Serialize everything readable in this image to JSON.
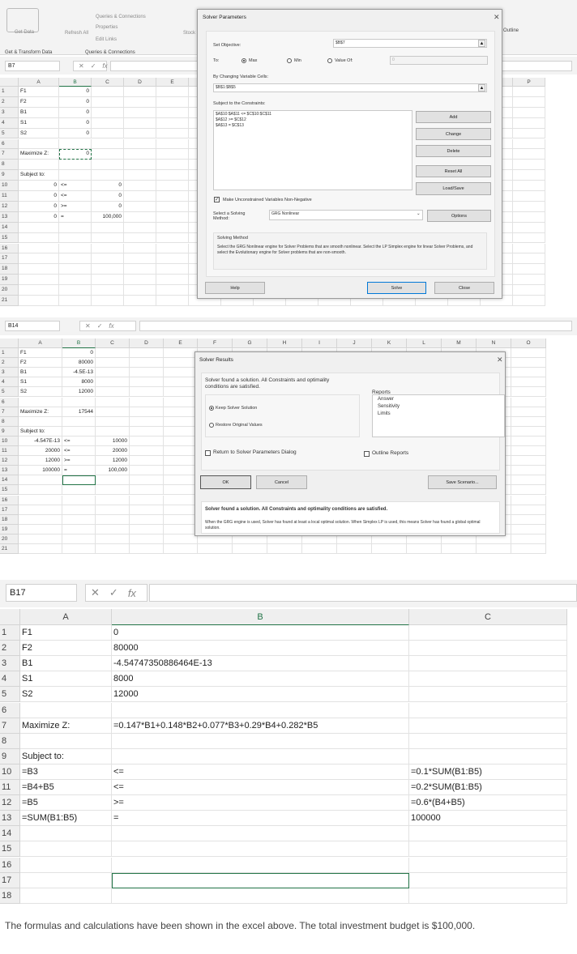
{
  "panel1": {
    "ribbon": {
      "get_data": "Get Data",
      "refresh_all": "Refresh All",
      "queries_connections_btn": "Queries & Connections",
      "properties": "Properties",
      "edit_links": "Edit Links",
      "group_get_transform": "Get & Transform Data",
      "group_queries": "Queries & Connections",
      "stocks": "Stock",
      "outline": "Outline"
    },
    "name_box": "B7",
    "fx": "fx",
    "columns": [
      "A",
      "B",
      "C",
      "D",
      "E",
      "F",
      "G",
      "H",
      "I",
      "J",
      "K",
      "L",
      "M",
      "N",
      "O",
      "P"
    ],
    "rows": [
      [
        "F1",
        "0",
        ""
      ],
      [
        "F2",
        "0",
        ""
      ],
      [
        "B1",
        "0",
        ""
      ],
      [
        "S1",
        "0",
        ""
      ],
      [
        "S2",
        "0",
        ""
      ],
      [
        "",
        "",
        ""
      ],
      [
        "Maximize Z:",
        "0",
        ""
      ],
      [
        "",
        "",
        ""
      ],
      [
        "Subject to:",
        "",
        ""
      ],
      [
        "0",
        "<=",
        "0"
      ],
      [
        "0",
        "<=",
        "0"
      ],
      [
        "0",
        ">=",
        "0"
      ],
      [
        "0",
        "=",
        "100,000"
      ],
      [
        "",
        "",
        ""
      ],
      [
        "",
        "",
        ""
      ],
      [
        "",
        "",
        ""
      ],
      [
        "",
        "",
        ""
      ],
      [
        "",
        "",
        ""
      ],
      [
        "",
        "",
        ""
      ],
      [
        "",
        "",
        ""
      ],
      [
        "",
        "",
        ""
      ]
    ],
    "solver_parameters": {
      "title": "Solver Parameters",
      "set_objective_label": "Set Objective:",
      "set_objective_value": "$B$7",
      "to_label": "To:",
      "max": "Max",
      "min": "Min",
      "value_of": "Value Of:",
      "value_of_value": "0",
      "selected_goal": "Max",
      "changing_cells_label": "By Changing Variable Cells:",
      "changing_cells_value": "$B$1:$B$5",
      "constraints_label": "Subject to the Constraints:",
      "constraints": [
        "$A$10:$A$11 <= $C$10:$C$11",
        "$A$12 >= $C$12",
        "$A$13 = $C$13"
      ],
      "buttons": {
        "add": "Add",
        "change": "Change",
        "delete": "Delete",
        "reset_all": "Reset All",
        "load_save": "Load/Save",
        "options": "Options",
        "help": "Help",
        "solve": "Solve",
        "close": "Close"
      },
      "nonneg_label": "Make Unconstrained Variables Non-Negative",
      "nonneg_checked": true,
      "method_label": "Select a Solving Method:",
      "method_value": "GRG Nonlinear",
      "method_group_title": "Solving Method",
      "method_description": "Select the GRG Nonlinear engine for Solver Problems that are smooth nonlinear. Select the LP Simplex engine for linear Solver Problems, and select the Evolutionary engine for Solver problems that are non-smooth."
    }
  },
  "panel2": {
    "name_box": "B14",
    "fx": "fx",
    "columns": [
      "A",
      "B",
      "C",
      "D",
      "E",
      "F",
      "G",
      "H",
      "I",
      "J",
      "K",
      "L",
      "M",
      "N",
      "O"
    ],
    "rows": [
      [
        "F1",
        "0",
        ""
      ],
      [
        "F2",
        "80000",
        ""
      ],
      [
        "B1",
        "-4.5E-13",
        ""
      ],
      [
        "S1",
        "8000",
        ""
      ],
      [
        "S2",
        "12000",
        ""
      ],
      [
        "",
        "",
        ""
      ],
      [
        "Maximize Z:",
        "17544",
        ""
      ],
      [
        "",
        "",
        ""
      ],
      [
        "Subject to:",
        "",
        ""
      ],
      [
        "-4.547E-13",
        "<=",
        "10000"
      ],
      [
        "20000",
        "<=",
        "20000"
      ],
      [
        "12000",
        ">=",
        "12000"
      ],
      [
        "100000",
        "=",
        "100,000"
      ],
      [
        "",
        "",
        ""
      ],
      [
        "",
        "",
        ""
      ],
      [
        "",
        "",
        ""
      ],
      [
        "",
        "",
        ""
      ],
      [
        "",
        "",
        ""
      ],
      [
        "",
        "",
        ""
      ],
      [
        "",
        "",
        ""
      ],
      [
        "",
        "",
        ""
      ]
    ],
    "solver_results": {
      "title": "Solver Results",
      "message": "Solver found a solution.  All Constraints and optimality conditions are satisfied.",
      "keep": "Keep Solver Solution",
      "restore": "Restore Original Values",
      "selected": "Keep Solver Solution",
      "reports_label": "Reports",
      "reports": [
        "Answer",
        "Sensitivity",
        "Limits"
      ],
      "return_label": "Return to Solver Parameters Dialog",
      "outline_label": "Outline Reports",
      "ok": "OK",
      "cancel": "Cancel",
      "save_scenario": "Save Scenario...",
      "footer_bold": "Solver found a solution.  All Constraints and optimality conditions are satisfied.",
      "footer_text": "When the GRG engine is used, Solver has found at least a local optimal solution. When Simplex LP is used, this means Solver has found a global optimal solution."
    }
  },
  "panel3": {
    "name_box": "B17",
    "fx": "fx",
    "columns": [
      "A",
      "B",
      "C"
    ],
    "rows": [
      [
        "F1",
        "0",
        ""
      ],
      [
        "F2",
        "80000",
        ""
      ],
      [
        "B1",
        "-4.54747350886464E-13",
        ""
      ],
      [
        "S1",
        "8000",
        ""
      ],
      [
        "S2",
        "12000",
        ""
      ],
      [
        "",
        "",
        ""
      ],
      [
        "Maximize Z:",
        "=0.147*B1+0.148*B2+0.077*B3+0.29*B4+0.282*B5",
        ""
      ],
      [
        "",
        "",
        ""
      ],
      [
        "Subject to:",
        "",
        ""
      ],
      [
        "=B3",
        "<=",
        "=0.1*SUM(B1:B5)"
      ],
      [
        "=B4+B5",
        "<=",
        "=0.2*SUM(B1:B5)"
      ],
      [
        "=B5",
        ">=",
        "=0.6*(B4+B5)"
      ],
      [
        "=SUM(B1:B5)",
        "=",
        "100000"
      ],
      [
        "",
        "",
        ""
      ],
      [
        "",
        "",
        ""
      ],
      [
        "",
        "",
        ""
      ],
      [
        "",
        "",
        ""
      ],
      [
        "",
        "",
        ""
      ]
    ]
  },
  "note": "The formulas and calculations have been shown in the excel above. The total investment budget is $100,000.",
  "colors": {
    "excel_green": "#217346",
    "dialog_bg": "#f0f0f0"
  }
}
